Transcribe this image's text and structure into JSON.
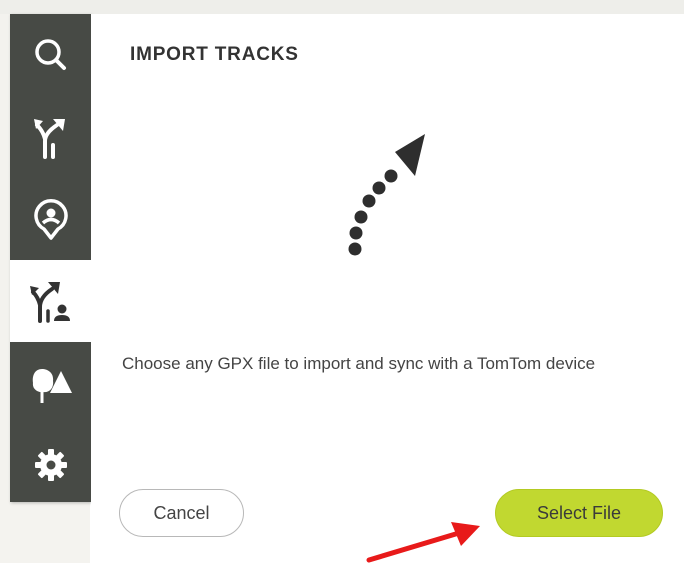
{
  "sidebar": {
    "items": [
      {
        "icon": "search-icon"
      },
      {
        "icon": "route-icon"
      },
      {
        "icon": "location-pin-icon"
      },
      {
        "icon": "import-track-icon",
        "active": true
      },
      {
        "icon": "poi-icon"
      },
      {
        "icon": "gear-icon"
      }
    ]
  },
  "dialog": {
    "title": "IMPORT TRACKS",
    "description": "Choose any GPX file to import and sync with a TomTom device",
    "cancel_label": "Cancel",
    "select_label": "Select File"
  },
  "colors": {
    "sidebar_bg": "#474a45",
    "accent": "#c1d830",
    "annotation": "#e81a1a"
  }
}
